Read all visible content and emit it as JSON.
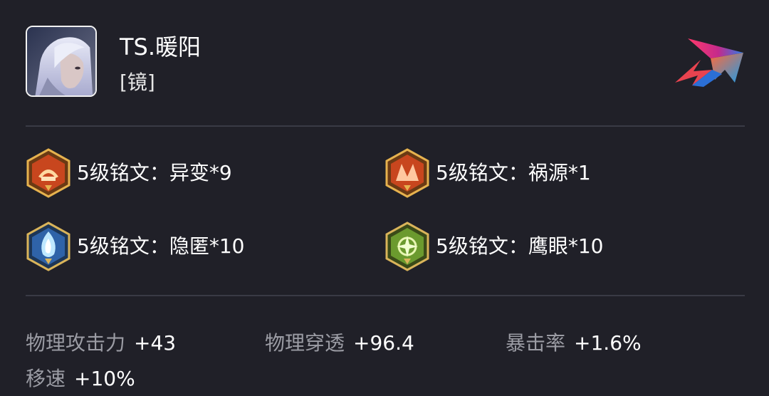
{
  "player": {
    "name": "TS.暖阳",
    "hero": "[镜]",
    "avatar_icon": "hero-portrait-icon"
  },
  "brand": {
    "icon": "game-logo-icon"
  },
  "runes": [
    {
      "label": "5级铭文：异变*9",
      "icon": "rune-red-icon",
      "color": "#c8461e"
    },
    {
      "label": "5级铭文：祸源*1",
      "icon": "rune-red-icon",
      "color": "#c8461e"
    },
    {
      "label": "5级铭文：隐匿*10",
      "icon": "rune-blue-icon",
      "color": "#2f63a8"
    },
    {
      "label": "5级铭文：鹰眼*10",
      "icon": "rune-green-icon",
      "color": "#6b9a2e"
    }
  ],
  "stats": [
    {
      "name": "物理攻击力",
      "value": "+43"
    },
    {
      "name": "物理穿透",
      "value": "+96.4"
    },
    {
      "name": "暴击率",
      "value": "+1.6%"
    },
    {
      "name": "移速",
      "value": "+10%"
    }
  ]
}
